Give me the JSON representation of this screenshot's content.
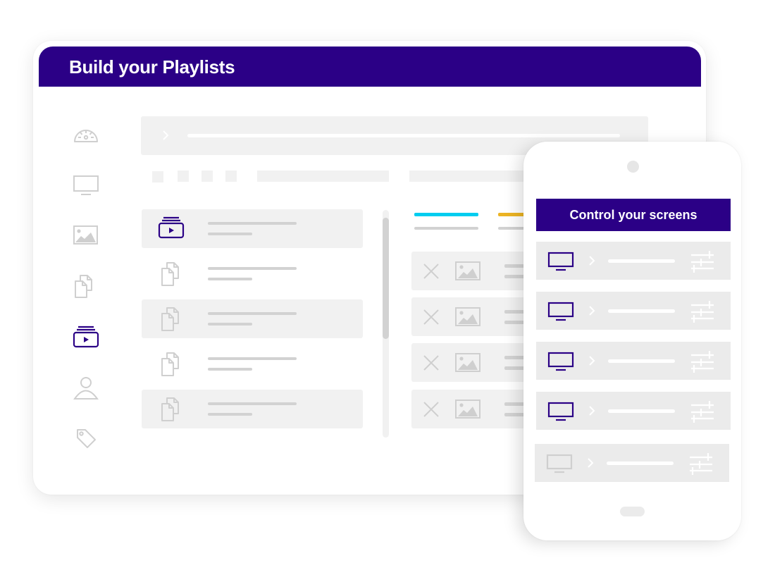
{
  "desktop": {
    "title": "Build your Playlists",
    "colors": {
      "brand": "#2b0086",
      "tab_active": "#00cdf0",
      "tab_secondary": "#ecb424",
      "placeholder": "#d2d2d2",
      "panel": "#f1f1f1"
    },
    "sidebar": {
      "items": [
        {
          "icon": "dashboard-gauge-icon",
          "active": false
        },
        {
          "icon": "monitor-icon",
          "active": false
        },
        {
          "icon": "image-icon",
          "active": false
        },
        {
          "icon": "documents-icon",
          "active": false
        },
        {
          "icon": "playlist-icon",
          "active": true
        },
        {
          "icon": "user-icon",
          "active": false
        },
        {
          "icon": "tag-icon",
          "active": false
        }
      ]
    },
    "breadcrumb": {
      "icon": "chevron-right-icon"
    },
    "playlist_list": [
      {
        "icon": "playlist-icon",
        "selected": true
      },
      {
        "icon": "documents-icon",
        "selected": false
      },
      {
        "icon": "documents-icon",
        "selected": false
      },
      {
        "icon": "documents-icon",
        "selected": false
      },
      {
        "icon": "documents-icon",
        "selected": false
      }
    ],
    "media_rows": [
      {
        "remove_icon": "close-icon",
        "thumb_icon": "image-icon"
      },
      {
        "remove_icon": "close-icon",
        "thumb_icon": "image-icon"
      },
      {
        "remove_icon": "close-icon",
        "thumb_icon": "image-icon"
      },
      {
        "remove_icon": "close-icon",
        "thumb_icon": "image-icon"
      }
    ]
  },
  "phone": {
    "title": "Control your screens",
    "screens": [
      {
        "icon": "monitor-icon",
        "online": true
      },
      {
        "icon": "monitor-icon",
        "online": true
      },
      {
        "icon": "monitor-icon",
        "online": true
      },
      {
        "icon": "monitor-icon",
        "online": true
      },
      {
        "icon": "monitor-icon",
        "online": false
      }
    ]
  }
}
